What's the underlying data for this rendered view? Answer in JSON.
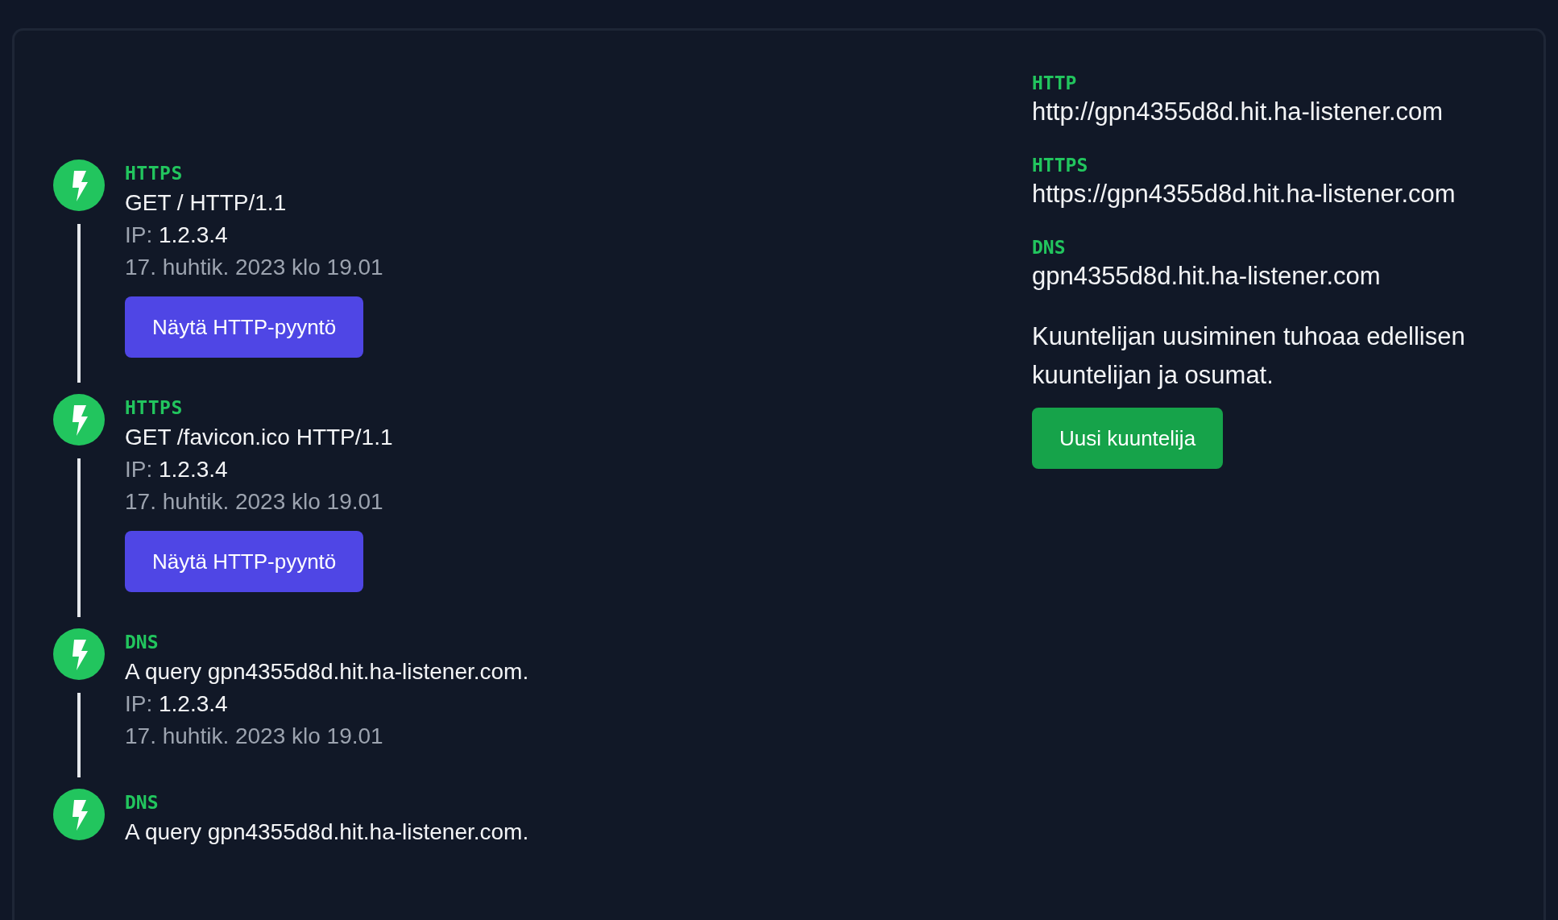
{
  "hits": [
    {
      "kind": "http",
      "type": "HTTPS",
      "request": "GET / HTTP/1.1",
      "ip_label": "IP:",
      "ip": "1.2.3.4",
      "time": "17. huhtik. 2023 klo 19.01",
      "button": "Näytä HTTP-pyyntö"
    },
    {
      "kind": "http",
      "type": "HTTPS",
      "request": "GET /favicon.ico HTTP/1.1",
      "ip_label": "IP:",
      "ip": "1.2.3.4",
      "time": "17. huhtik. 2023 klo 19.01",
      "button": "Näytä HTTP-pyyntö"
    },
    {
      "kind": "dns",
      "type": "DNS",
      "request": "A query gpn4355d8d.hit.ha-listener.com.",
      "ip_label": "IP:",
      "ip": "1.2.3.4",
      "time": "17. huhtik. 2023 klo 19.01"
    },
    {
      "kind": "dns",
      "type": "DNS",
      "request": "A query gpn4355d8d.hit.ha-listener.com."
    }
  ],
  "endpoints": [
    {
      "label": "HTTP",
      "value": "http://gpn4355d8d.hit.ha-listener.com"
    },
    {
      "label": "HTTPS",
      "value": "https://gpn4355d8d.hit.ha-listener.com"
    },
    {
      "label": "DNS",
      "value": "gpn4355d8d.hit.ha-listener.com"
    }
  ],
  "notice": "Kuuntelijan uusiminen tuhoaa edellisen kuuntelijan ja osumat.",
  "new_button": "Uusi kuuntelija"
}
